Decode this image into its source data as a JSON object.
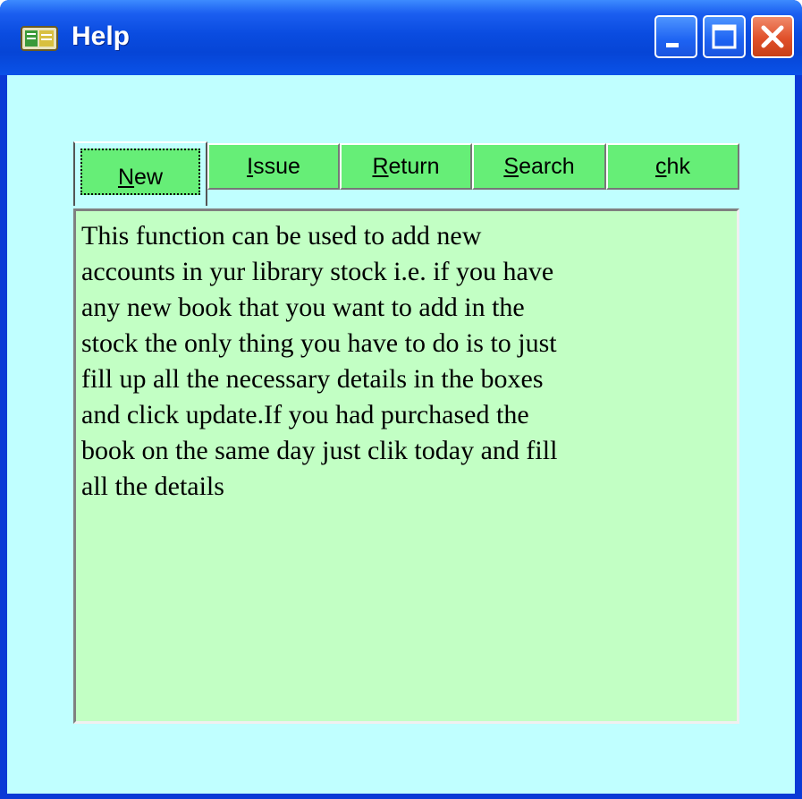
{
  "window": {
    "title": "Help",
    "icon": "library-app-icon"
  },
  "tabs": [
    {
      "label": "New",
      "accel": "N",
      "rest": "ew",
      "active": true
    },
    {
      "label": "Issue",
      "accel": "I",
      "rest": "ssue",
      "active": false
    },
    {
      "label": "Return",
      "accel": "R",
      "rest": "eturn",
      "active": false
    },
    {
      "label": "Search",
      "accel": "S",
      "rest": "earch",
      "active": false
    },
    {
      "label": "chk",
      "accel": "c",
      "rest": "hk",
      "active": false
    }
  ],
  "help_text": "This function can be used to add new\naccounts in yur library stock i.e. if you have\nany new book that you want to add in the\nstock the only thing you have to do is to just\nfill up all the necessary details in the boxes\nand click update.If you had purchased the\nbook on the same day just clik today and fill\nall the details",
  "colors": {
    "titlebar": "#0a4ce0",
    "client_bg": "#c0ffff",
    "tab_bg": "#66ee77",
    "textbox_bg": "#c2ffc4",
    "close_button": "#e0502a"
  }
}
